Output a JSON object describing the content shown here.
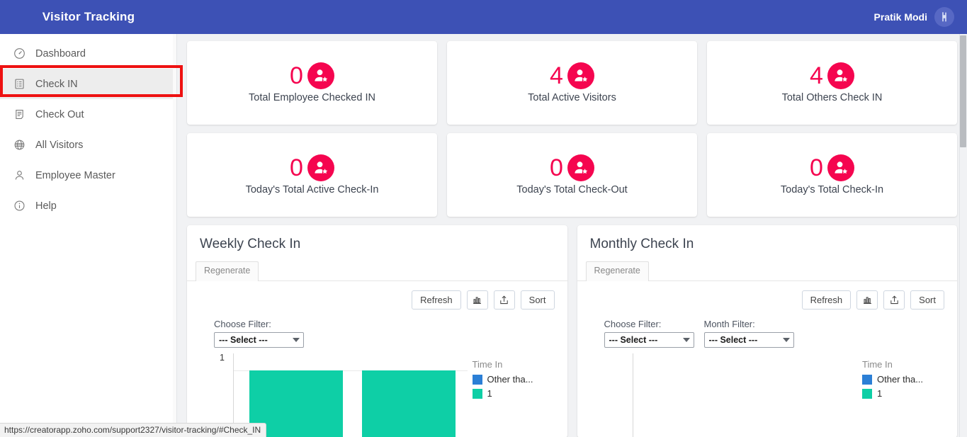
{
  "brand": {
    "title": "Visitor Tracking"
  },
  "topbar": {
    "user_name": "Pratik Modi",
    "avatar_glyph": "Ⓙ"
  },
  "sidebar": {
    "items": [
      {
        "label": "Dashboard",
        "icon": "gauge-icon",
        "active": false
      },
      {
        "label": "Check IN",
        "icon": "clipboard-list-icon",
        "active": true
      },
      {
        "label": "Check Out",
        "icon": "document-icon",
        "active": false
      },
      {
        "label": "All Visitors",
        "icon": "globe-icon",
        "active": false
      },
      {
        "label": "Employee Master",
        "icon": "person-icon",
        "active": false
      },
      {
        "label": "Help",
        "icon": "info-icon",
        "active": false
      }
    ]
  },
  "stats": [
    {
      "value": "0",
      "label": "Total Employee Checked IN",
      "icon": "user-star-icon"
    },
    {
      "value": "4",
      "label": "Total Active Visitors",
      "icon": "user-star-icon"
    },
    {
      "value": "4",
      "label": "Total Others Check IN",
      "icon": "user-star-icon"
    },
    {
      "value": "0",
      "label": "Today's Total Active Check-In",
      "icon": "user-star-icon"
    },
    {
      "value": "0",
      "label": "Today's Total Check-Out",
      "icon": "user-star-icon"
    },
    {
      "value": "0",
      "label": "Today's Total Check-In",
      "icon": "user-star-icon"
    }
  ],
  "panels": [
    {
      "title": "Weekly Check In",
      "tab_label": "Regenerate",
      "toolbar": {
        "refresh_label": "Refresh",
        "chart_icon": "bar-chart-icon",
        "export_icon": "export-icon",
        "sort_label": "Sort"
      },
      "filters": [
        {
          "label": "Choose Filter:",
          "value": "--- Select ---"
        }
      ]
    },
    {
      "title": "Monthly Check In",
      "tab_label": "Regenerate",
      "toolbar": {
        "refresh_label": "Refresh",
        "chart_icon": "bar-chart-icon",
        "export_icon": "export-icon",
        "sort_label": "Sort"
      },
      "filters": [
        {
          "label": "Choose Filter:",
          "value": "--- Select ---"
        },
        {
          "label": "Month Filter:",
          "value": "--- Select ---"
        }
      ]
    }
  ],
  "chart_data": [
    {
      "type": "bar",
      "title": "Weekly Check In",
      "categories": [
        "",
        ""
      ],
      "values": [
        1,
        1
      ],
      "ylim": [
        0,
        1
      ],
      "yticks": [
        "1"
      ],
      "xlabel": "",
      "ylabel": "",
      "grid": true,
      "legend_position": "right",
      "legend_title": "Time In",
      "legend": [
        {
          "label": "Other tha...",
          "color": "#2b7fd6"
        },
        {
          "label": "1",
          "color": "#0ecfa6"
        }
      ],
      "bar_color": "#0ecfa6"
    },
    {
      "type": "bar",
      "title": "Monthly Check In",
      "categories": [],
      "values": [],
      "ylim": [
        0,
        1
      ],
      "yticks": [],
      "xlabel": "",
      "ylabel": "",
      "grid": false,
      "legend_position": "right",
      "legend_title": "Time In",
      "legend": [
        {
          "label": "Other tha...",
          "color": "#2b7fd6"
        },
        {
          "label": "1",
          "color": "#0ecfa6"
        }
      ],
      "bar_color": "#0ecfa6"
    }
  ],
  "statusbar": {
    "url": "https://creatorapp.zoho.com/support2327/visitor-tracking/#Check_IN"
  },
  "colors": {
    "header_blue": "#3d51b5",
    "accent_crimson": "#f5054f",
    "teal": "#0ecfa6",
    "legend_blue": "#2b7fd6",
    "annotation_red": "#ee1111",
    "content_bg": "#f1f2f4"
  }
}
